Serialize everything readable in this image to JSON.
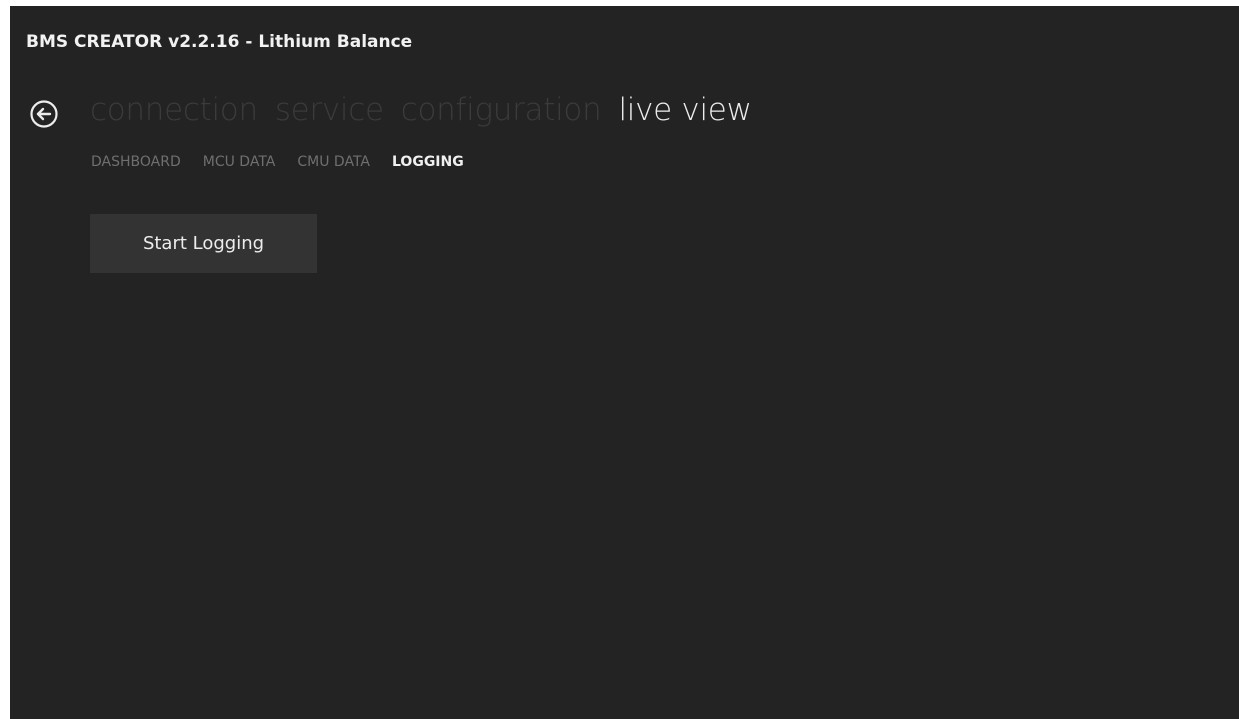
{
  "app": {
    "title": "BMS CREATOR v2.2.16 - Lithium Balance"
  },
  "icons": {
    "back": "back-arrow-circle-icon"
  },
  "pivot": {
    "items": [
      {
        "label": "connection",
        "active": false
      },
      {
        "label": "service",
        "active": false
      },
      {
        "label": "configuration",
        "active": false
      },
      {
        "label": "live view",
        "active": true
      }
    ]
  },
  "subnav": {
    "items": [
      {
        "label": "DASHBOARD",
        "active": false
      },
      {
        "label": "MCU DATA",
        "active": false
      },
      {
        "label": "CMU DATA",
        "active": false
      },
      {
        "label": "LOGGING",
        "active": true
      }
    ]
  },
  "logging": {
    "start_label": "Start Logging"
  },
  "colors": {
    "background": "#232323",
    "pivot_inactive": "#3b3b3b",
    "pivot_active": "#ececec",
    "subnav_inactive": "#6f6f6f",
    "subnav_active": "#f0f0f0",
    "button_bg": "#333333"
  }
}
